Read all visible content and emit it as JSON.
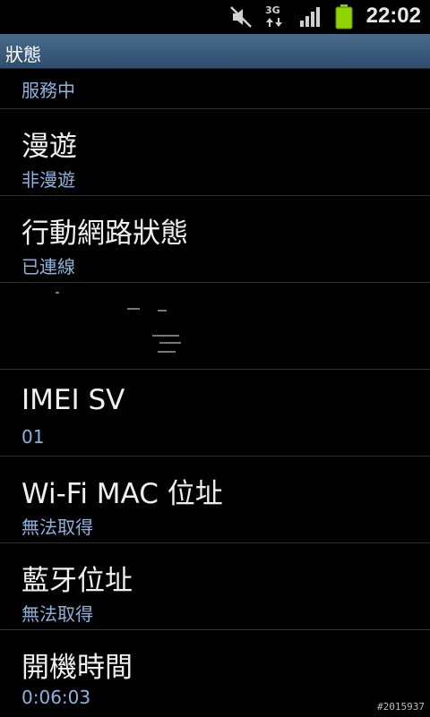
{
  "status_bar": {
    "time": "22:02",
    "network_type": "3G",
    "icons": [
      "mute-icon",
      "3g-data-icon",
      "signal-icon",
      "battery-icon"
    ]
  },
  "title_bar": {
    "title": "狀態"
  },
  "items": [
    {
      "label": "",
      "value": "服務中"
    },
    {
      "label": "漫遊",
      "value": "非漫遊"
    },
    {
      "label": "行動網路狀態",
      "value": "已連線"
    },
    {
      "label": "",
      "value": ""
    },
    {
      "label": "IMEI SV",
      "value": "01"
    },
    {
      "label": "Wi-Fi MAC 位址",
      "value": "無法取得"
    },
    {
      "label": "藍牙位址",
      "value": "無法取得"
    },
    {
      "label": "開機時間",
      "value": "0:06:03"
    }
  ],
  "watermark": "#2015937",
  "colors": {
    "title_bar": "#3d5c7d",
    "value_text": "#8ab4e0",
    "battery": "#8fd400"
  }
}
